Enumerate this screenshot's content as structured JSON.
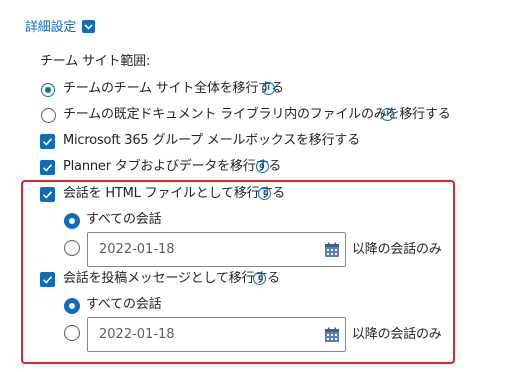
{
  "header": {
    "title": "詳細設定"
  },
  "team_site": {
    "label": "チーム サイト範囲:",
    "options": [
      {
        "label": "チームのチーム サイト全体を移行する",
        "selected": true
      },
      {
        "label": "チームの既定ドキュメント ライブラリ内のファイルのみを移行する",
        "selected": false
      }
    ]
  },
  "checkboxes": [
    {
      "label": "Microsoft 365 グループ メールボックスを移行する",
      "checked": true
    },
    {
      "label": "Planner タブおよびデータを移行する",
      "checked": true
    }
  ],
  "html_section": {
    "label": "会話を HTML ファイルとして移行する",
    "checked": true,
    "all_label": "すべての会話",
    "date_value": "2022-01-18",
    "after_label": "以降の会話のみ"
  },
  "post_section": {
    "label": "会話を投稿メッセージとして移行する",
    "checked": true,
    "all_label": "すべての会話",
    "date_value": "2022-01-18",
    "after_label": "以降の会話のみ"
  },
  "info_glyph": "i",
  "colors": {
    "accent": "#0f6cbd",
    "highlight": "#e0242a"
  }
}
